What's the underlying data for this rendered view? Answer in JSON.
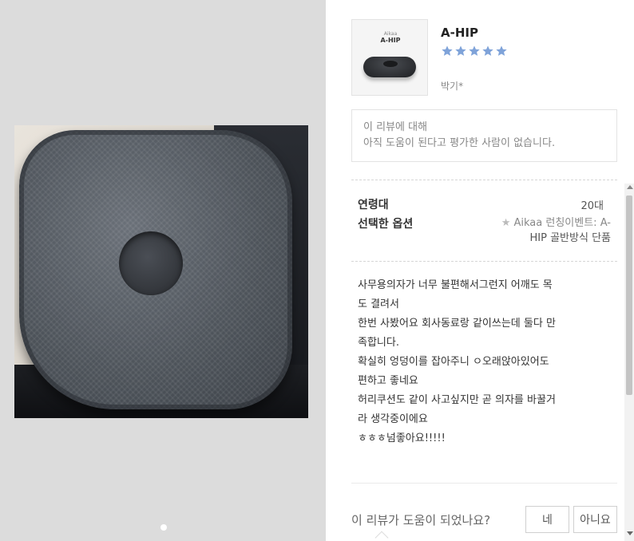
{
  "product": {
    "thumb_brand": "Aikaa",
    "thumb_model": "A-HIP",
    "name": "A-HIP",
    "rating": 5,
    "rating_max": 5,
    "star_color": "#7fa3d9",
    "reviewer": "박기*"
  },
  "helpful_box": {
    "line1": "이 리뷰에 대해",
    "line2": "아직 도움이 된다고 평가한 사람이 없습니다."
  },
  "info": {
    "age_label": "연령대",
    "age_value": "20대",
    "option_label": "선택한 옵션",
    "option_star": "★",
    "option_line1": " Aikaa 런칭이벤트:  A-",
    "option_line2": "HIP 골반방식 단품"
  },
  "review": {
    "lines": [
      "사무용의자가 너무 불편해서그런지 어깨도 목",
      "도 결려서",
      "한번 사봤어요 회사동료랑 같이쓰는데 둘다 만",
      "족합니다.",
      "확실히 엉덩이를 잡아주니 ㅇ오래앉아있어도",
      "편하고 좋네요",
      "허리쿠션도 같이 사고싶지만 곧 의자를 바꿀거",
      "라 생각중이에요",
      "ㅎㅎㅎ넘좋아요!!!!!"
    ]
  },
  "feedback": {
    "question": "이 리뷰가 도움이 되었나요?",
    "yes_label": "네",
    "no_label": "아니요"
  },
  "gallery": {
    "page_index": 1,
    "page_count": 1
  }
}
